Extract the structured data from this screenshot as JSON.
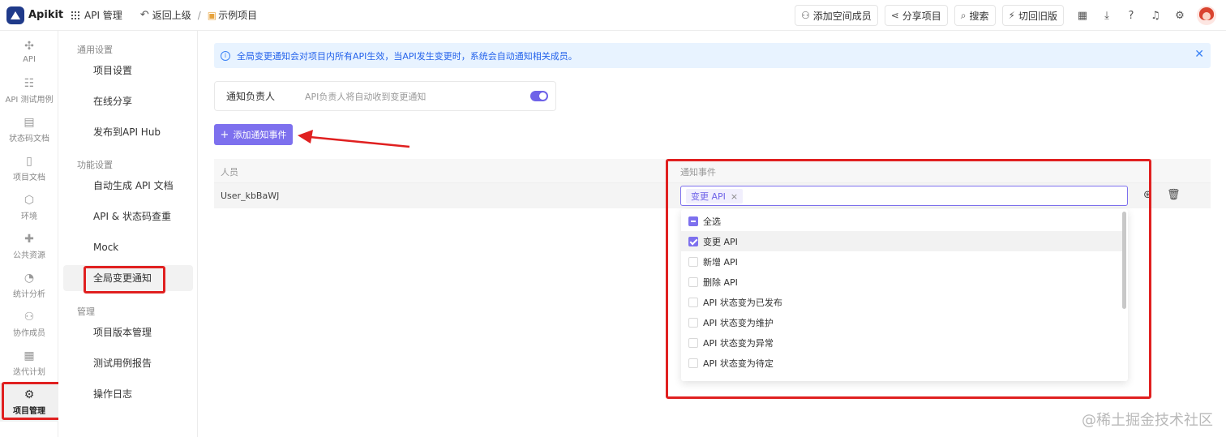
{
  "app": {
    "name": "Apikit"
  },
  "topbar": {
    "api_manage": "API 管理",
    "back": "返回上级",
    "separator": "/",
    "project_name": "示例项目",
    "buttons": {
      "add_member": "添加空间成员",
      "share": "分享项目",
      "search": "搜索",
      "old_version": "切回旧版"
    }
  },
  "rail": {
    "items": [
      {
        "label": "API",
        "icon": "api-icon"
      },
      {
        "label": "API 测试用例",
        "icon": "test-case-icon"
      },
      {
        "label": "状态码文档",
        "icon": "status-code-icon"
      },
      {
        "label": "项目文档",
        "icon": "document-icon"
      },
      {
        "label": "环境",
        "icon": "environment-icon"
      },
      {
        "label": "公共资源",
        "icon": "puzzle-icon"
      },
      {
        "label": "统计分析",
        "icon": "chart-icon"
      },
      {
        "label": "协作成员",
        "icon": "members-icon"
      },
      {
        "label": "迭代计划",
        "icon": "calendar-icon"
      },
      {
        "label": "项目管理",
        "icon": "gear-icon",
        "active": true
      }
    ]
  },
  "subnav": {
    "group_general": "通用设置",
    "group_feature": "功能设置",
    "group_manage": "管理",
    "items": [
      {
        "label": "项目设置"
      },
      {
        "label": "在线分享"
      },
      {
        "label": "发布到API Hub"
      },
      {
        "label": "自动生成 API 文档"
      },
      {
        "label": "API & 状态码查重"
      },
      {
        "label": "Mock"
      },
      {
        "label": "全局变更通知",
        "active": true
      },
      {
        "label": "项目版本管理"
      },
      {
        "label": "测试用例报告"
      },
      {
        "label": "操作日志"
      }
    ]
  },
  "main": {
    "info": "全局变更通知会对项目内所有API生效，当API发生变更时，系统会自动通知相关成员。",
    "notify_owner": {
      "label": "通知负责人",
      "desc": "API负责人将自动收到变更通知",
      "enabled": true
    },
    "add_button": "添加通知事件",
    "table": {
      "headers": [
        "人员",
        "通知事件"
      ],
      "rows": [
        {
          "person": "User_kbBaWJ",
          "events": [
            "变更 API"
          ]
        }
      ]
    },
    "dropdown": {
      "options": [
        {
          "label": "全选",
          "state": "indeterminate"
        },
        {
          "label": "变更 API",
          "state": "checked"
        },
        {
          "label": "新增 API",
          "state": "unchecked"
        },
        {
          "label": "删除 API",
          "state": "unchecked"
        },
        {
          "label": "API 状态变为已发布",
          "state": "unchecked"
        },
        {
          "label": "API 状态变为维护",
          "state": "unchecked"
        },
        {
          "label": "API 状态变为异常",
          "state": "unchecked"
        },
        {
          "label": "API 状态变为待定",
          "state": "unchecked"
        }
      ]
    }
  },
  "watermark": "@稀土掘金技术社区",
  "colors": {
    "accent": "#7d70ee",
    "highlight_box": "#e02020",
    "info_bg": "#e8f3ff"
  }
}
